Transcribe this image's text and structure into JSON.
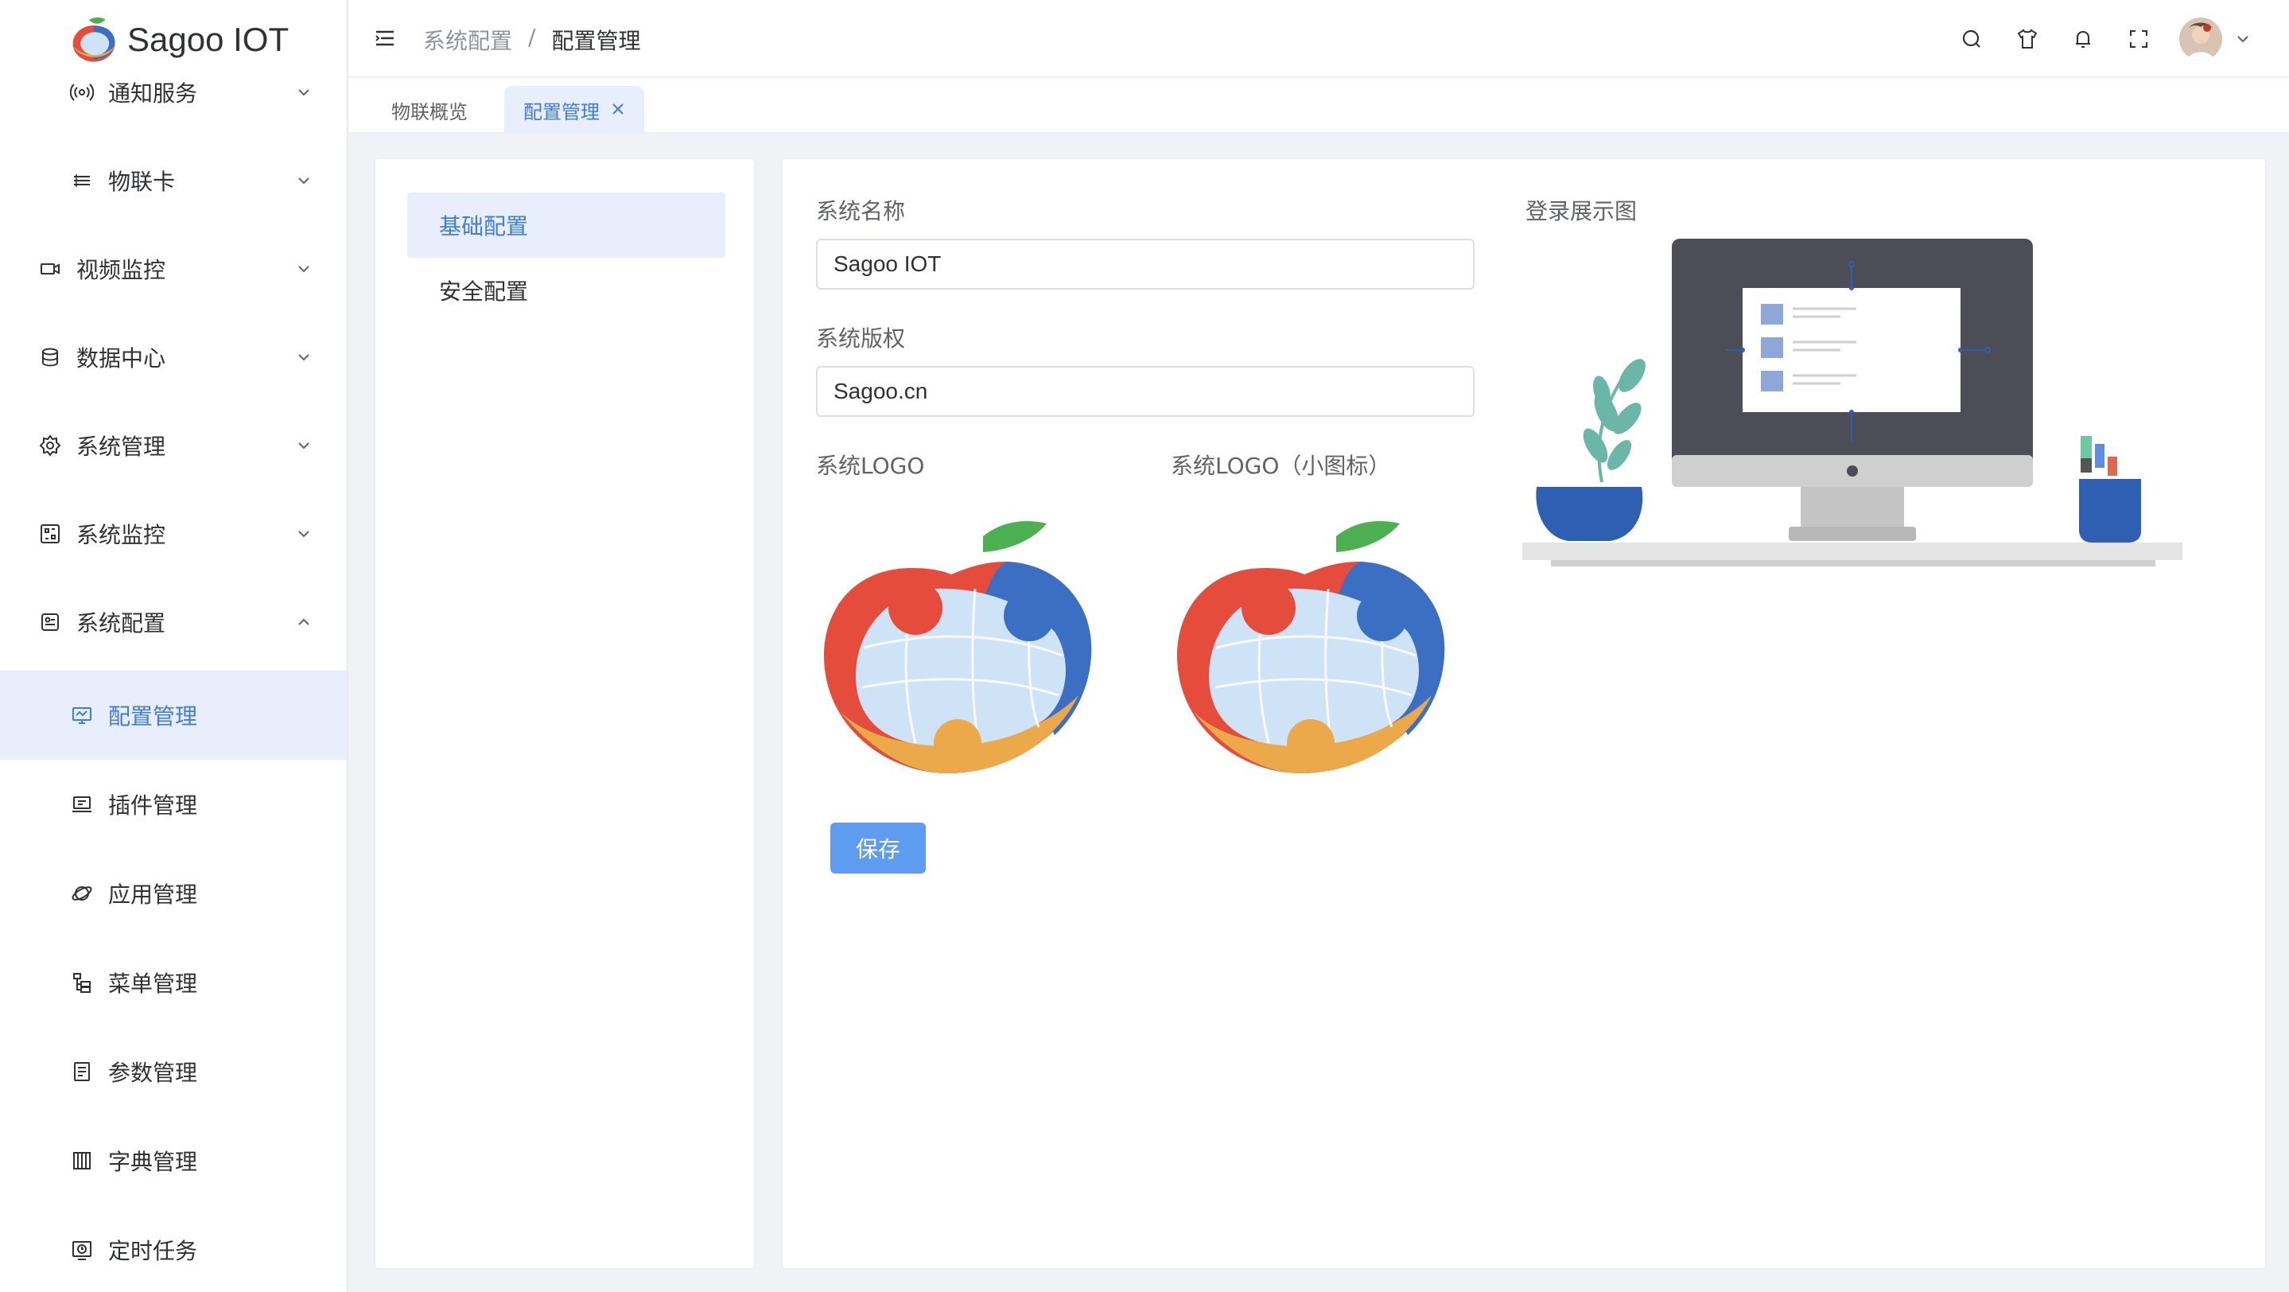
{
  "app": {
    "name": "Sagoo IOT"
  },
  "sidebar": {
    "items": [
      {
        "label": "通知服务",
        "icon": "broadcast-icon",
        "level": "sub",
        "expanded": false
      },
      {
        "label": "物联卡",
        "icon": "sim-card-icon",
        "level": "sub",
        "expanded": false
      },
      {
        "label": "视频监控",
        "icon": "video-camera-icon",
        "level": "top",
        "expanded": false
      },
      {
        "label": "数据中心",
        "icon": "database-icon",
        "level": "top",
        "expanded": false
      },
      {
        "label": "系统管理",
        "icon": "gear-icon",
        "level": "top",
        "expanded": false
      },
      {
        "label": "系统监控",
        "icon": "monitor-grid-icon",
        "level": "top",
        "expanded": false
      },
      {
        "label": "系统配置",
        "icon": "config-icon",
        "level": "top",
        "expanded": true
      },
      {
        "label": "配置管理",
        "icon": "screen-icon",
        "level": "sub",
        "active": true
      },
      {
        "label": "插件管理",
        "icon": "plugin-icon",
        "level": "sub"
      },
      {
        "label": "应用管理",
        "icon": "planet-icon",
        "level": "sub"
      },
      {
        "label": "菜单管理",
        "icon": "menu-tree-icon",
        "level": "sub"
      },
      {
        "label": "参数管理",
        "icon": "document-icon",
        "level": "sub"
      },
      {
        "label": "字典管理",
        "icon": "dictionary-icon",
        "level": "sub"
      },
      {
        "label": "定时任务",
        "icon": "scheduled-task-icon",
        "level": "sub"
      }
    ]
  },
  "header": {
    "breadcrumb": {
      "parent": "系统配置",
      "separator": "/",
      "current": "配置管理"
    },
    "icons": [
      "search-icon",
      "shirt-icon",
      "bell-icon",
      "fullscreen-icon",
      "avatar",
      "chevron-down-icon"
    ]
  },
  "tabs": [
    {
      "label": "物联概览",
      "active": false
    },
    {
      "label": "配置管理",
      "active": true,
      "closable": true
    }
  ],
  "config_menu": [
    {
      "label": "基础配置",
      "active": true
    },
    {
      "label": "安全配置",
      "active": false
    }
  ],
  "form": {
    "system_name": {
      "label": "系统名称",
      "value": "Sagoo IOT"
    },
    "copyright": {
      "label": "系统版权",
      "value": "Sagoo.cn"
    },
    "logo_label": "系统LOGO",
    "logo_small_label": "系统LOGO（小图标）",
    "login_image_label": "登录展示图",
    "save_label": "保存"
  },
  "colors": {
    "accent": "#3f7de0",
    "active_bg": "#e8eefb",
    "save_button": "#5d9cf0",
    "logo_red": "#e64c3c",
    "logo_blue": "#3a6fc4",
    "logo_orange": "#eca94a",
    "logo_green": "#4caf50"
  }
}
